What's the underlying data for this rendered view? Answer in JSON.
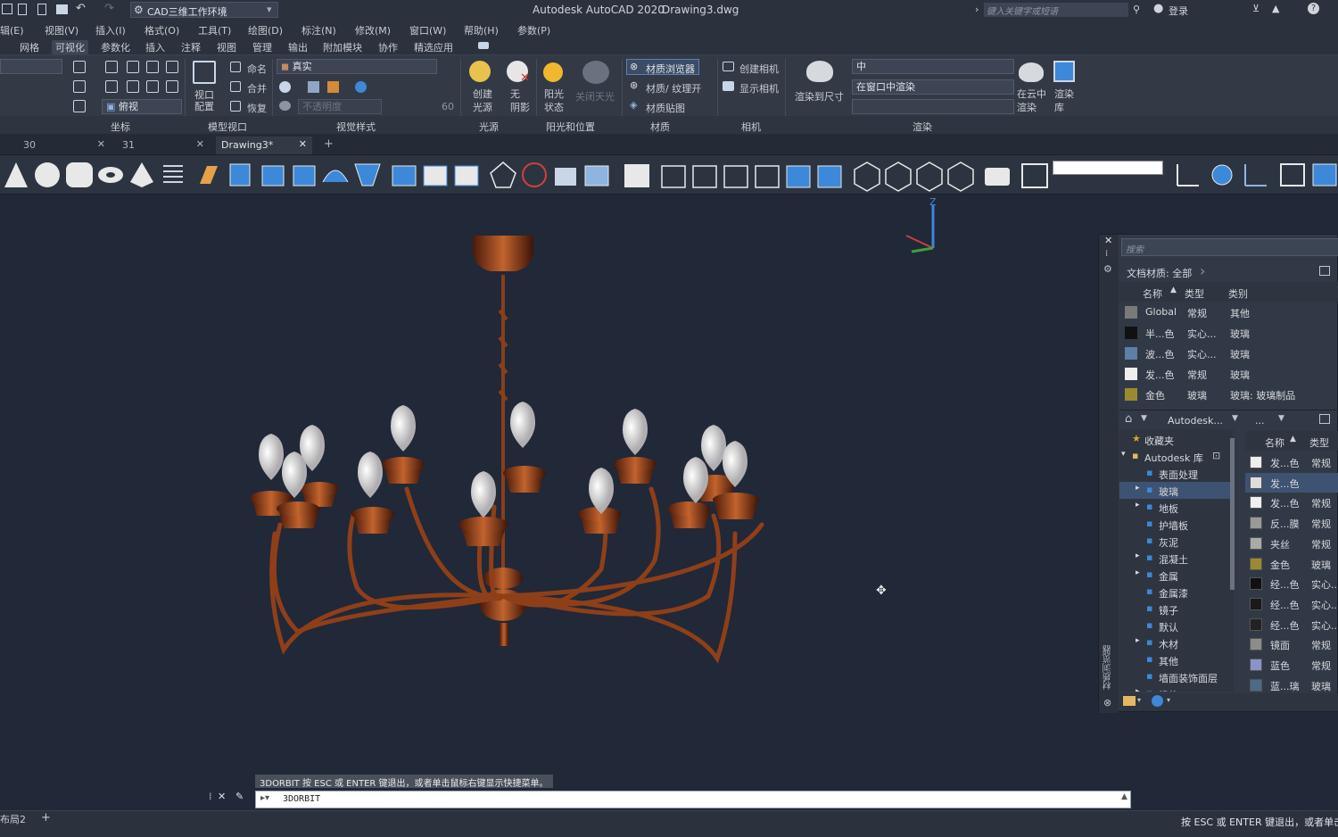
{
  "title": {
    "workspace": "CAD三维工作环境",
    "app_title": "Autodesk AutoCAD 2020",
    "drawing": "Drawing3.dwg",
    "search_placeholder": "键入关键字或短语",
    "login": "登录"
  },
  "menu": [
    "辑(E)",
    "视图(V)",
    "插入(I)",
    "格式(O)",
    "工具(T)",
    "绘图(D)",
    "标注(N)",
    "修改(M)",
    "窗口(W)",
    "帮助(H)",
    "参数(P)"
  ],
  "ribbon_tabs": [
    "网格",
    "可视化",
    "参数化",
    "插入",
    "注释",
    "视图",
    "管理",
    "输出",
    "附加模块",
    "协作",
    "精选应用"
  ],
  "ribbon": {
    "view_name": "俯视",
    "viewport_config": "视口\n配置",
    "named": "命名",
    "join": "合并",
    "restore": "恢复",
    "visual_style": "真实",
    "opacity_placeholder": "不透明度",
    "opacity_value": "60",
    "create_light": "创建\n光源",
    "no_shadow": "无\n阴影",
    "sun_status": "阳光\n状态",
    "sky_off": "关闭天光",
    "materials_browser": "材质浏览器",
    "material_texture": "材质/ 纹理开",
    "material_map": "材质贴图",
    "create_camera": "创建相机",
    "show_camera": "显示相机",
    "render_to_size": "渲染到尺寸",
    "render_quality": "中",
    "render_in": "在窗口中渲染",
    "cloud_render": "在云中\n渲染",
    "render_lib": "渲染\n库",
    "panels": [
      "坐标",
      "模型视口",
      "视觉样式",
      "光源",
      "阳光和位置",
      "材质",
      "相机",
      "渲染"
    ]
  },
  "doc_tabs": [
    "30",
    "31",
    "Drawing3*"
  ],
  "ucs": {
    "z_label": "Z"
  },
  "materials_panel": {
    "search_placeholder": "搜索",
    "doc_materials": "文档材质: 全部",
    "headers": [
      "名称",
      "类型",
      "类别"
    ],
    "doc_rows": [
      {
        "name": "Global",
        "type": "常规",
        "category": "其他",
        "swatch": "#7a7a7a"
      },
      {
        "name": "半...色",
        "type": "实心...",
        "category": "玻璃",
        "swatch": "#111111"
      },
      {
        "name": "波...色",
        "type": "实心...",
        "category": "玻璃",
        "swatch": "#5d7fa8"
      },
      {
        "name": "发...色",
        "type": "常规",
        "category": "玻璃",
        "swatch": "#eeeeee"
      },
      {
        "name": "金色",
        "type": "玻璃",
        "category": "玻璃: 玻璃制品",
        "swatch": "#9c8a2e"
      }
    ],
    "lib_name": "Autodesk...",
    "lib_ellipsis": "...",
    "tree": [
      "收藏夹",
      "Autodesk 库",
      "表面处理",
      "玻璃",
      "地板",
      "护墙板",
      "灰泥",
      "混凝土",
      "金属",
      "金属漆",
      "镜子",
      "默认",
      "木材",
      "其他",
      "墙面装饰面层",
      "墙体"
    ],
    "lib_headers": [
      "名称",
      "类型"
    ],
    "lib_rows": [
      {
        "name": "发...色",
        "type": "常规",
        "swatch": "#eeeeee"
      },
      {
        "name": "发...色",
        "type": "",
        "swatch": "#dddddd"
      },
      {
        "name": "发...色",
        "type": "常规",
        "swatch": "#f0f0f0"
      },
      {
        "name": "反...膜",
        "type": "常规",
        "swatch": "#999999"
      },
      {
        "name": "夹丝",
        "type": "常规",
        "swatch": "#aaaaaa"
      },
      {
        "name": "金色",
        "type": "玻璃",
        "swatch": "#9c8a2e"
      },
      {
        "name": "经...色",
        "type": "实心...",
        "swatch": "#111111"
      },
      {
        "name": "经...色",
        "type": "实心...",
        "swatch": "#1a1a1a"
      },
      {
        "name": "经...色",
        "type": "实心...",
        "swatch": "#222222"
      },
      {
        "name": "镜面",
        "type": "常规",
        "swatch": "#8c8c8c"
      },
      {
        "name": "蓝色",
        "type": "常规",
        "swatch": "#8a94c8"
      },
      {
        "name": "蓝...璃",
        "type": "玻璃",
        "swatch": "#4d6a86"
      }
    ],
    "side_label": "材质浏览器"
  },
  "command": {
    "tooltip": "3DORBIT 按 ESC 或 ENTER 键退出，或者单击鼠标右键显示快捷菜单。",
    "input": "3DORBIT"
  },
  "status": {
    "layout": "布局2",
    "message": "按 ESC 或 ENTER 键退出，或者单击鼠"
  }
}
